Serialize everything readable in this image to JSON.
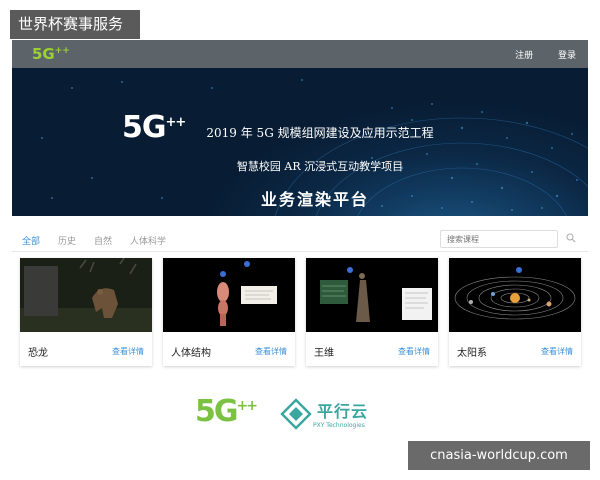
{
  "overlay": {
    "corner_label": "世界杯赛事服务",
    "watermark": "cnasia-worldcup.com"
  },
  "header": {
    "logo": "5G",
    "logo_sup": "++",
    "nav": [
      "注册",
      "登录"
    ]
  },
  "hero": {
    "logo": "5G",
    "logo_sup": "++",
    "line1": "2019 年 5G 规模组网建设及应用示范工程",
    "line2": "智慧校园 AR 沉浸式互动教学项目",
    "line3": "业务渲染平台"
  },
  "tabs": [
    {
      "label": "全部",
      "active": true
    },
    {
      "label": "历史",
      "active": false
    },
    {
      "label": "自然",
      "active": false
    },
    {
      "label": "人体科学",
      "active": false
    }
  ],
  "search": {
    "placeholder": "搜索课程"
  },
  "cards": [
    {
      "title": "恐龙",
      "link": "查看详情"
    },
    {
      "title": "人体结构",
      "link": "查看详情"
    },
    {
      "title": "王维",
      "link": "查看详情"
    },
    {
      "title": "太阳系",
      "link": "查看详情"
    }
  ],
  "footer": {
    "logo_5g": "5G",
    "logo_5g_sup": "++",
    "pxy_name": "平行云",
    "pxy_sub": "PXY Technologies"
  },
  "colors": {
    "topbar": "#5c6469",
    "accent_blue": "#3b8fd6",
    "brand_green": "#7cc242",
    "pxy_teal": "#3aa6a0"
  }
}
